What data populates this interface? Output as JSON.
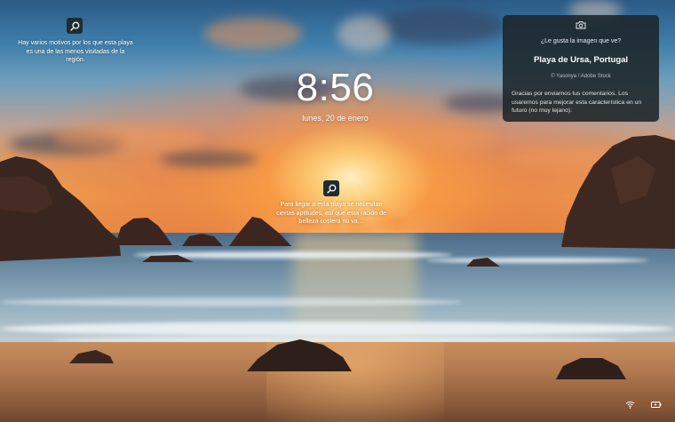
{
  "lockscreen": {
    "time": "8:56",
    "date": "lunes, 20 de enero"
  },
  "tips": {
    "left": "Hay varios motivos por los que esta playa es una de las menos visitadas de la región.",
    "center": "Para llegar a esta playa se necesitan ciertas aptitudes, así que esta ración de belleza costera no va…"
  },
  "spotlight": {
    "question": "¿Le gusta la imagen que ve?",
    "location": "Playa de Ursa, Portugal",
    "credit": "© Yasonya / Adobe Stock",
    "body": "Gracias por enviarnos tus comentarios. Los usaremos para mejorar esta característica en un futuro (no muy lejano)."
  },
  "icons": {
    "tip_left": "search-icon",
    "tip_center": "search-icon",
    "spotlight": "camera-icon",
    "network": "wifi-icon",
    "battery": "battery-icon"
  },
  "colors": {
    "card_bg": "#1c2428",
    "tip_icon_bg": "#1f2d33"
  }
}
